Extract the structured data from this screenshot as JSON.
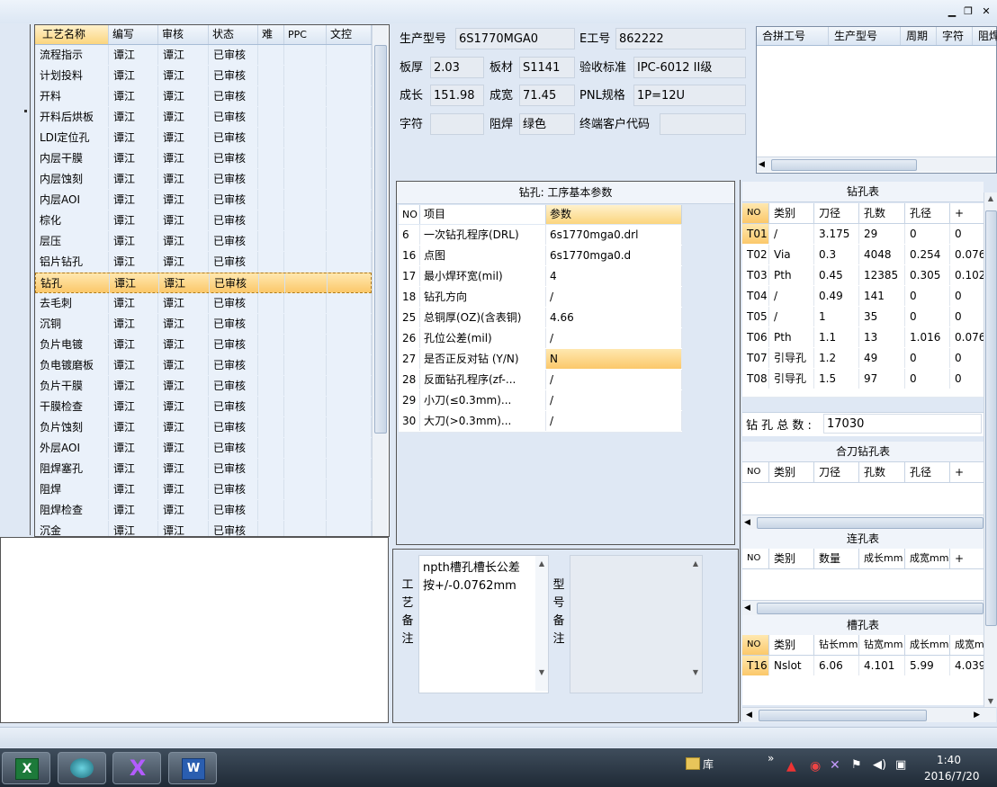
{
  "window": {
    "min_icon": "minimize-icon",
    "restore_icon": "restore-icon",
    "close_icon": "close-icon",
    "min": "▁",
    "restore": "❐",
    "close": "✕"
  },
  "process_table": {
    "headers": [
      "工艺名称",
      "编写",
      "审核",
      "状态",
      "难",
      "PPC",
      "文控"
    ],
    "rows": [
      [
        "流程指示",
        "谭江",
        "谭江",
        "已审核"
      ],
      [
        "计划投料",
        "谭江",
        "谭江",
        "已审核"
      ],
      [
        "开料",
        "谭江",
        "谭江",
        "已审核"
      ],
      [
        "开料后烘板",
        "谭江",
        "谭江",
        "已审核"
      ],
      [
        "LDI定位孔",
        "谭江",
        "谭江",
        "已审核"
      ],
      [
        "内层干膜",
        "谭江",
        "谭江",
        "已审核"
      ],
      [
        "内层蚀刻",
        "谭江",
        "谭江",
        "已审核"
      ],
      [
        "内层AOI",
        "谭江",
        "谭江",
        "已审核"
      ],
      [
        "棕化",
        "谭江",
        "谭江",
        "已审核"
      ],
      [
        "层压",
        "谭江",
        "谭江",
        "已审核"
      ],
      [
        "铝片钻孔",
        "谭江",
        "谭江",
        "已审核"
      ],
      [
        "钻孔",
        "谭江",
        "谭江",
        "已审核"
      ],
      [
        "去毛刺",
        "谭江",
        "谭江",
        "已审核"
      ],
      [
        "沉铜",
        "谭江",
        "谭江",
        "已审核"
      ],
      [
        "负片电镀",
        "谭江",
        "谭江",
        "已审核"
      ],
      [
        "负电镀磨板",
        "谭江",
        "谭江",
        "已审核"
      ],
      [
        "负片干膜",
        "谭江",
        "谭江",
        "已审核"
      ],
      [
        "干膜检查",
        "谭江",
        "谭江",
        "已审核"
      ],
      [
        "负片蚀刻",
        "谭江",
        "谭江",
        "已审核"
      ],
      [
        "外层AOI",
        "谭江",
        "谭江",
        "已审核"
      ],
      [
        "阻焊塞孔",
        "谭江",
        "谭江",
        "已审核"
      ],
      [
        "阻焊",
        "谭江",
        "谭江",
        "已审核"
      ],
      [
        "阻焊检查",
        "谭江",
        "谭江",
        "已审核"
      ],
      [
        "沉金",
        "谭江",
        "谭江",
        "已审核"
      ]
    ],
    "selected_index": 11
  },
  "info": {
    "model_label": "生产型号",
    "model": "6S1770MGA0",
    "eno_label": "E工号",
    "eno": "862222",
    "thickness_label": "板厚",
    "thickness": "2.03",
    "material_label": "板材",
    "material": "S1141",
    "standard_label": "验收标准",
    "standard": "IPC-6012 II级",
    "length_label": "成长",
    "length": "151.98",
    "width_label": "成宽",
    "width": "71.45",
    "pnl_label": "PNL规格",
    "pnl": "1P=12U",
    "char_label": "字符",
    "char": "",
    "mask_label": "阻焊",
    "mask": "绿色",
    "customer_label": "终端客户代码",
    "customer": ""
  },
  "merge_table": {
    "headers": [
      "合拼工号",
      "生产型号",
      "周期",
      "字符",
      "阻焊"
    ]
  },
  "drill_params": {
    "title": "钻孔: 工序基本参数",
    "headers": [
      "NO",
      "项目",
      "参数"
    ],
    "rows": [
      [
        "6",
        "一次钻孔程序(DRL)",
        "6s1770mga0.drl"
      ],
      [
        "16",
        "点图",
        "6s1770mga0.d"
      ],
      [
        "17",
        "最小焊环宽(mil)",
        "4"
      ],
      [
        "18",
        "钻孔方向",
        "/"
      ],
      [
        "25",
        "总铜厚(OZ)(含表铜)",
        "4.66"
      ],
      [
        "26",
        "孔位公差(mil)",
        "/"
      ],
      [
        "27",
        "是否正反对钻 (Y/N)",
        "N"
      ],
      [
        "28",
        "反面钻孔程序(zf-...",
        "/"
      ],
      [
        "29",
        "小刀(≤0.3mm)...",
        "/"
      ],
      [
        "30",
        "大刀(>0.3mm)...",
        "/"
      ]
    ],
    "highlight_index": 6
  },
  "notes": {
    "process_label": "工艺备注",
    "process_text": "npth槽孔槽长公差按+/-0.0762mm",
    "model_label": "型号备注",
    "model_text": ""
  },
  "drill_table": {
    "title": "钻孔表",
    "headers": [
      "NO",
      "类别",
      "刀径",
      "孔数",
      "孔径",
      "+"
    ],
    "rows": [
      [
        "T01",
        "/",
        "3.175",
        "29",
        "0",
        "0"
      ],
      [
        "T02",
        "Via",
        "0.3",
        "4048",
        "0.254",
        "0.076"
      ],
      [
        "T03",
        "Pth",
        "0.45",
        "12385",
        "0.305",
        "0.102"
      ],
      [
        "T04",
        "/",
        "0.49",
        "141",
        "0",
        "0"
      ],
      [
        "T05",
        "/",
        "1",
        "35",
        "0",
        "0"
      ],
      [
        "T06",
        "Pth",
        "1.1",
        "13",
        "1.016",
        "0.076"
      ],
      [
        "T07",
        "引导孔",
        "1.2",
        "49",
        "0",
        "0"
      ],
      [
        "T08",
        "引导孔",
        "1.5",
        "97",
        "0",
        "0"
      ]
    ],
    "total_label": "钻 孔 总 数 :",
    "total": "17030"
  },
  "combo_table": {
    "title": "合刀钻孔表",
    "headers": [
      "NO",
      "类别",
      "刀径",
      "孔数",
      "孔径",
      "+"
    ]
  },
  "chain_table": {
    "title": "连孔表",
    "headers": [
      "NO",
      "类别",
      "数量",
      "成长mm",
      "成宽mm",
      "+"
    ]
  },
  "slot_table": {
    "title": "槽孔表",
    "headers": [
      "NO",
      "类别",
      "钻长mm",
      "钻宽mm",
      "成长mm",
      "成宽mm"
    ],
    "rows": [
      [
        "T16",
        "Nslot",
        "6.06",
        "4.101",
        "5.99",
        "4.039"
      ]
    ]
  },
  "taskbar": {
    "apps": [
      "excel-icon",
      "media-icon",
      "xshell-icon",
      "word-icon"
    ],
    "lib_label": "库",
    "chevron": "»",
    "time": "1:40",
    "date": "2016/7/20"
  },
  "colors": {
    "selection": "#fbc86a",
    "panel": "#dfe8f4",
    "header_blue": "#dbe6f3"
  }
}
